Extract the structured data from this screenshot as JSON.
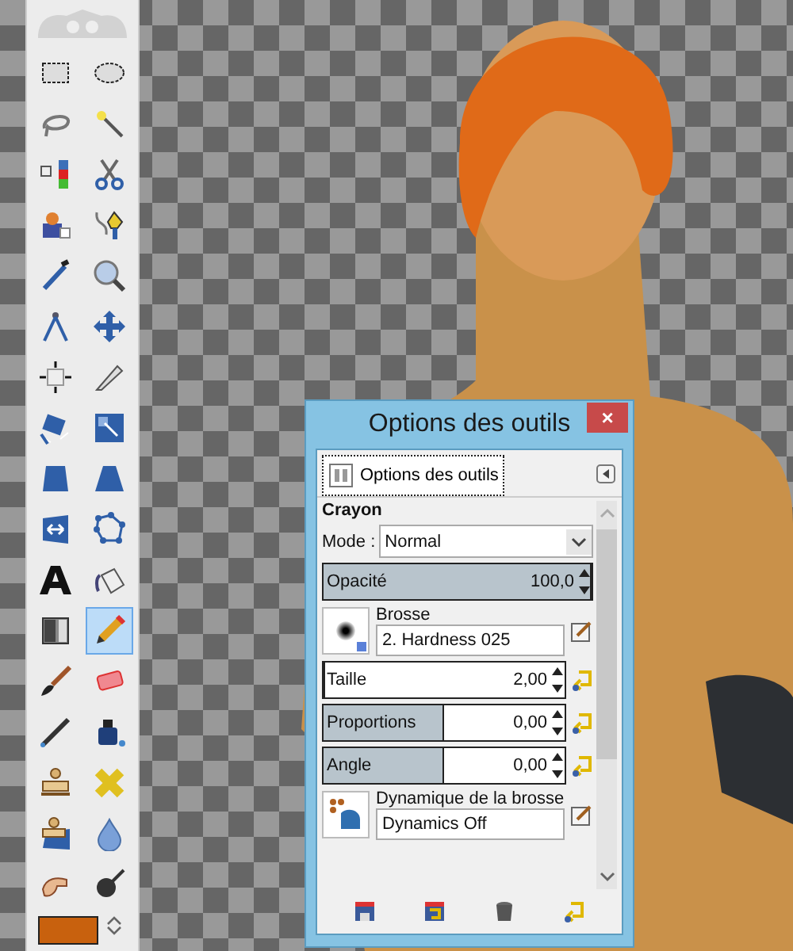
{
  "toolbox": {
    "tools": [
      {
        "kind": "rect-select",
        "selected": false
      },
      {
        "kind": "ellipse-select",
        "selected": false
      },
      {
        "kind": "lasso",
        "selected": false
      },
      {
        "kind": "wand",
        "selected": false
      },
      {
        "kind": "color-select",
        "selected": false
      },
      {
        "kind": "scissors",
        "selected": false
      },
      {
        "kind": "fg-select",
        "selected": false
      },
      {
        "kind": "paths",
        "selected": false
      },
      {
        "kind": "picker",
        "selected": false
      },
      {
        "kind": "zoom",
        "selected": false
      },
      {
        "kind": "measure",
        "selected": false
      },
      {
        "kind": "move",
        "selected": false
      },
      {
        "kind": "align",
        "selected": false
      },
      {
        "kind": "knife",
        "selected": false
      },
      {
        "kind": "rotate",
        "selected": false
      },
      {
        "kind": "scale",
        "selected": false
      },
      {
        "kind": "shear",
        "selected": false
      },
      {
        "kind": "perspective",
        "selected": false
      },
      {
        "kind": "flip",
        "selected": false
      },
      {
        "kind": "cage",
        "selected": false
      },
      {
        "kind": "text",
        "selected": false
      },
      {
        "kind": "bucket",
        "selected": false
      },
      {
        "kind": "gradient",
        "selected": false
      },
      {
        "kind": "pencil",
        "selected": true
      },
      {
        "kind": "brush",
        "selected": false
      },
      {
        "kind": "eraser",
        "selected": false
      },
      {
        "kind": "airbrush",
        "selected": false
      },
      {
        "kind": "ink",
        "selected": false
      },
      {
        "kind": "clone",
        "selected": false
      },
      {
        "kind": "heal",
        "selected": false
      },
      {
        "kind": "persp-clone",
        "selected": false
      },
      {
        "kind": "blur",
        "selected": false
      },
      {
        "kind": "smudge",
        "selected": false
      },
      {
        "kind": "dodge",
        "selected": false
      }
    ],
    "swap_colors": true
  },
  "dialog": {
    "title": "Options des outils",
    "close": "×",
    "tab": {
      "label": "Options des outils",
      "selected": true
    },
    "tool_name": "Crayon",
    "mode": {
      "label": "Mode :",
      "value": "Normal"
    },
    "opacity": {
      "label": "Opacité",
      "reading": "100,0",
      "level": 1
    },
    "brush": {
      "label": "Brosse",
      "value": "2. Hardness 025"
    },
    "sliders": [
      {
        "label": "Taille",
        "reading": "2,00",
        "level": 0
      },
      {
        "label": "Proportions",
        "reading": "0,00",
        "level": 0.5
      },
      {
        "label": "Angle",
        "reading": "0,00",
        "level": 0.5
      }
    ],
    "dynamics": {
      "label": "Dynamique de la brosse",
      "value": "Dynamics Off"
    }
  }
}
